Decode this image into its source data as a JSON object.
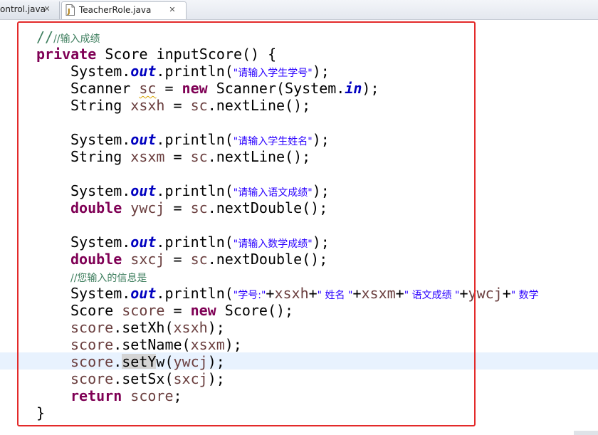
{
  "tabs": [
    {
      "label": "ontrol.java",
      "active": false
    },
    {
      "label": "TeacherRole.java",
      "active": true
    }
  ],
  "colors": {
    "keyword": "#7f0055",
    "field": "#0000c0",
    "string": "#2a00ff",
    "comment": "#3f7f5f",
    "variable": "#6a3e3e",
    "highlight_box": "#e32a2a",
    "current_line": "#e8f2fe"
  },
  "code": {
    "l1_comment": "//输入成绩",
    "l2_private": "private",
    "l2_rest": " Score inputScore() {",
    "l3_a": "System.",
    "l3_out": "out",
    "l3_b": ".println(",
    "l3_str": "\"请输入学生学号\"",
    "l3_c": ");",
    "l4_a": "Scanner ",
    "l4_sc": "sc",
    "l4_b": " = ",
    "l4_new": "new",
    "l4_c": " Scanner(System.",
    "l4_in": "in",
    "l4_d": ");",
    "l5_a": "String ",
    "l5_var": "xsxh",
    "l5_b": " = ",
    "l5_sc": "sc",
    "l5_c": ".nextLine();",
    "l7_a": "System.",
    "l7_out": "out",
    "l7_b": ".println(",
    "l7_str": "\"请输入学生姓名\"",
    "l7_c": ");",
    "l8_a": "String ",
    "l8_var": "xsxm",
    "l8_b": " = ",
    "l8_sc": "sc",
    "l8_c": ".nextLine();",
    "l10_a": "System.",
    "l10_out": "out",
    "l10_b": ".println(",
    "l10_str": "\"请输入语文成绩\"",
    "l10_c": ");",
    "l11_kw": "double",
    "l11_sp": " ",
    "l11_var": "ywcj",
    "l11_b": " = ",
    "l11_sc": "sc",
    "l11_c": ".nextDouble();",
    "l13_a": "System.",
    "l13_out": "out",
    "l13_b": ".println(",
    "l13_str": "\"请输入数学成绩\"",
    "l13_c": ");",
    "l14_kw": "double",
    "l14_sp": " ",
    "l14_var": "sxcj",
    "l14_b": " = ",
    "l14_sc": "sc",
    "l14_c": ".nextDouble();",
    "l15_comment": "//您输入的信息是",
    "l16_a": "System.",
    "l16_out": "out",
    "l16_b": ".println(",
    "l16_s1": "\"学号:\"",
    "l16_p1": "+",
    "l16_v1": "xsxh",
    "l16_p2": "+",
    "l16_s2": "\" 姓名 \"",
    "l16_p3": "+",
    "l16_v2": "xsxm",
    "l16_p4": "+",
    "l16_s3": "\" 语文成绩 \"",
    "l16_p5": "+",
    "l16_v3": "ywcj",
    "l16_p6": "+",
    "l16_s4": "\" 数学",
    "l17_a": "Score ",
    "l17_var": "score",
    "l17_b": " = ",
    "l17_new": "new",
    "l17_c": " Score();",
    "l18_var": "score",
    "l18_a": ".setXh(",
    "l18_arg": "xsxh",
    "l18_b": ");",
    "l19_var": "score",
    "l19_a": ".setName(",
    "l19_arg": "xsxm",
    "l19_b": ");",
    "l20_var": "score",
    "l20_dot": ".",
    "l20_method": "setYw",
    "l20_a": "(",
    "l20_arg": "ywcj",
    "l20_b": ");",
    "l21_var": "score",
    "l21_a": ".setSx(",
    "l21_arg": "sxcj",
    "l21_b": ");",
    "l22_kw": "return",
    "l22_sp": " ",
    "l22_var": "score",
    "l22_b": ";",
    "l23": "}"
  }
}
